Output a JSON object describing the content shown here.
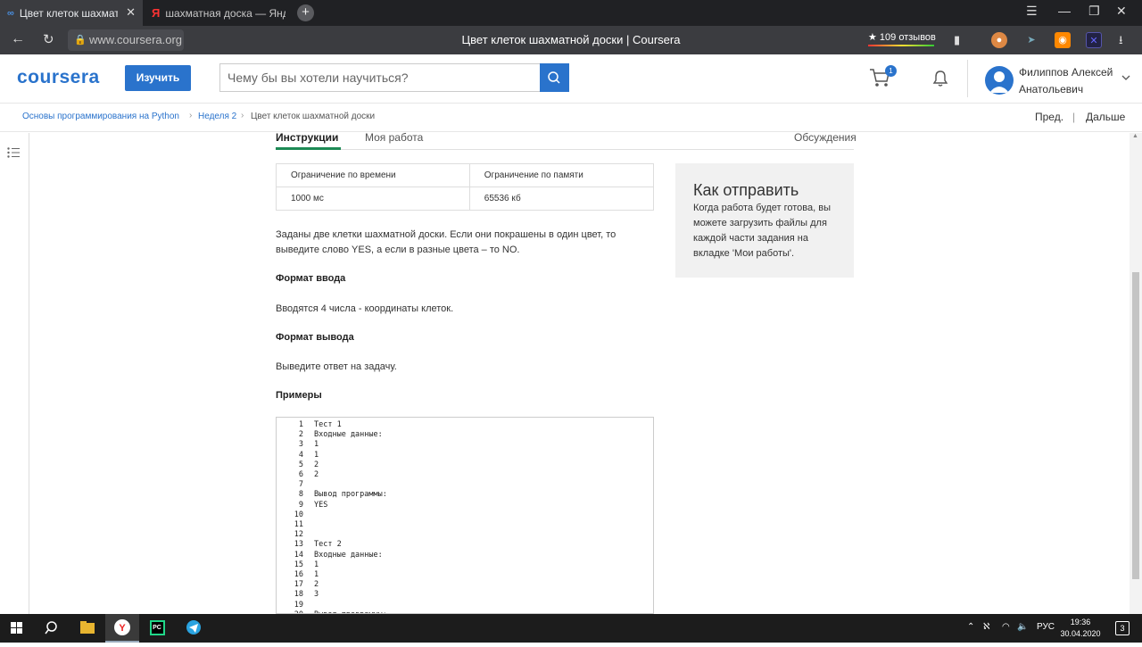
{
  "browser": {
    "tabs": [
      {
        "title": "Цвет клеток шахматно",
        "icon": "coursera-icon"
      },
      {
        "title": "шахматная доска — Янде",
        "icon": "yandex-icon"
      }
    ],
    "url": "www.coursera.org",
    "page_title": "Цвет клеток шахматной доски | Coursera",
    "reviews": "★ 109 отзывов"
  },
  "header": {
    "logo": "coursera",
    "learn_button": "Изучить",
    "search_placeholder": "Чему бы вы хотели научиться?",
    "cart_count": "1",
    "user_name_line1": "Филиппов Алексей",
    "user_name_line2": "Анатольевич"
  },
  "breadcrumb": {
    "items": [
      "Основы программирования на Python",
      "Неделя 2",
      "Цвет клеток шахматной доски"
    ],
    "prev": "Пред.",
    "sep": "|",
    "next": "Дальше"
  },
  "tabs": {
    "instructions": "Инструкции",
    "my_work": "Моя работа",
    "discussions": "Обсуждения"
  },
  "limits": {
    "headers": [
      "Ограничение по времени",
      "Ограничение по памяти"
    ],
    "values": [
      "1000 мс",
      "65536 кб"
    ]
  },
  "task": {
    "description": "Заданы две клетки шахматной доски. Если они покрашены в один цвет, то выведите слово YES, а если в разные цвета – то NO.",
    "input_heading": "Формат ввода",
    "input_text": "Вводятся 4 числа - координаты клеток.",
    "output_heading": "Формат вывода",
    "output_text": "Выведите ответ на задачу.",
    "examples_heading": "Примеры"
  },
  "how_to_submit": {
    "title": "Как отправить",
    "body": "Когда работа будет готова, вы можете загрузить файлы для каждой части задания на вкладке 'Мои работы'."
  },
  "code_lines": [
    {
      "n": "1",
      "t": "Тест 1"
    },
    {
      "n": "2",
      "t": "Входные данные:"
    },
    {
      "n": "3",
      "t": "1"
    },
    {
      "n": "4",
      "t": "1"
    },
    {
      "n": "5",
      "t": "2"
    },
    {
      "n": "6",
      "t": "2"
    },
    {
      "n": "7",
      "t": ""
    },
    {
      "n": "8",
      "t": "Вывод программы:"
    },
    {
      "n": "9",
      "t": "YES"
    },
    {
      "n": "10",
      "t": ""
    },
    {
      "n": "11",
      "t": ""
    },
    {
      "n": "12",
      "t": ""
    },
    {
      "n": "13",
      "t": "Тест 2"
    },
    {
      "n": "14",
      "t": "Входные данные:"
    },
    {
      "n": "15",
      "t": "1"
    },
    {
      "n": "16",
      "t": "1"
    },
    {
      "n": "17",
      "t": "2"
    },
    {
      "n": "18",
      "t": "3"
    },
    {
      "n": "19",
      "t": ""
    },
    {
      "n": "20",
      "t": "Вывод программы:"
    }
  ],
  "taskbar": {
    "lang": "РУС",
    "time": "19:36",
    "date": "30.04.2020",
    "notif_count": "3"
  }
}
